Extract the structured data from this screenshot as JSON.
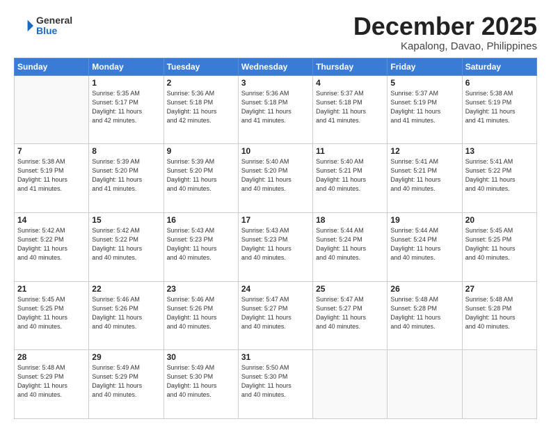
{
  "header": {
    "logo": {
      "general": "General",
      "blue": "Blue"
    },
    "month": "December 2025",
    "location": "Kapalong, Davao, Philippines"
  },
  "calendar": {
    "weekdays": [
      "Sunday",
      "Monday",
      "Tuesday",
      "Wednesday",
      "Thursday",
      "Friday",
      "Saturday"
    ],
    "weeks": [
      [
        {
          "day": "",
          "info": ""
        },
        {
          "day": "1",
          "info": "Sunrise: 5:35 AM\nSunset: 5:17 PM\nDaylight: 11 hours\nand 42 minutes."
        },
        {
          "day": "2",
          "info": "Sunrise: 5:36 AM\nSunset: 5:18 PM\nDaylight: 11 hours\nand 42 minutes."
        },
        {
          "day": "3",
          "info": "Sunrise: 5:36 AM\nSunset: 5:18 PM\nDaylight: 11 hours\nand 41 minutes."
        },
        {
          "day": "4",
          "info": "Sunrise: 5:37 AM\nSunset: 5:18 PM\nDaylight: 11 hours\nand 41 minutes."
        },
        {
          "day": "5",
          "info": "Sunrise: 5:37 AM\nSunset: 5:19 PM\nDaylight: 11 hours\nand 41 minutes."
        },
        {
          "day": "6",
          "info": "Sunrise: 5:38 AM\nSunset: 5:19 PM\nDaylight: 11 hours\nand 41 minutes."
        }
      ],
      [
        {
          "day": "7",
          "info": "Sunrise: 5:38 AM\nSunset: 5:19 PM\nDaylight: 11 hours\nand 41 minutes."
        },
        {
          "day": "8",
          "info": "Sunrise: 5:39 AM\nSunset: 5:20 PM\nDaylight: 11 hours\nand 41 minutes."
        },
        {
          "day": "9",
          "info": "Sunrise: 5:39 AM\nSunset: 5:20 PM\nDaylight: 11 hours\nand 40 minutes."
        },
        {
          "day": "10",
          "info": "Sunrise: 5:40 AM\nSunset: 5:20 PM\nDaylight: 11 hours\nand 40 minutes."
        },
        {
          "day": "11",
          "info": "Sunrise: 5:40 AM\nSunset: 5:21 PM\nDaylight: 11 hours\nand 40 minutes."
        },
        {
          "day": "12",
          "info": "Sunrise: 5:41 AM\nSunset: 5:21 PM\nDaylight: 11 hours\nand 40 minutes."
        },
        {
          "day": "13",
          "info": "Sunrise: 5:41 AM\nSunset: 5:22 PM\nDaylight: 11 hours\nand 40 minutes."
        }
      ],
      [
        {
          "day": "14",
          "info": "Sunrise: 5:42 AM\nSunset: 5:22 PM\nDaylight: 11 hours\nand 40 minutes."
        },
        {
          "day": "15",
          "info": "Sunrise: 5:42 AM\nSunset: 5:22 PM\nDaylight: 11 hours\nand 40 minutes."
        },
        {
          "day": "16",
          "info": "Sunrise: 5:43 AM\nSunset: 5:23 PM\nDaylight: 11 hours\nand 40 minutes."
        },
        {
          "day": "17",
          "info": "Sunrise: 5:43 AM\nSunset: 5:23 PM\nDaylight: 11 hours\nand 40 minutes."
        },
        {
          "day": "18",
          "info": "Sunrise: 5:44 AM\nSunset: 5:24 PM\nDaylight: 11 hours\nand 40 minutes."
        },
        {
          "day": "19",
          "info": "Sunrise: 5:44 AM\nSunset: 5:24 PM\nDaylight: 11 hours\nand 40 minutes."
        },
        {
          "day": "20",
          "info": "Sunrise: 5:45 AM\nSunset: 5:25 PM\nDaylight: 11 hours\nand 40 minutes."
        }
      ],
      [
        {
          "day": "21",
          "info": "Sunrise: 5:45 AM\nSunset: 5:25 PM\nDaylight: 11 hours\nand 40 minutes."
        },
        {
          "day": "22",
          "info": "Sunrise: 5:46 AM\nSunset: 5:26 PM\nDaylight: 11 hours\nand 40 minutes."
        },
        {
          "day": "23",
          "info": "Sunrise: 5:46 AM\nSunset: 5:26 PM\nDaylight: 11 hours\nand 40 minutes."
        },
        {
          "day": "24",
          "info": "Sunrise: 5:47 AM\nSunset: 5:27 PM\nDaylight: 11 hours\nand 40 minutes."
        },
        {
          "day": "25",
          "info": "Sunrise: 5:47 AM\nSunset: 5:27 PM\nDaylight: 11 hours\nand 40 minutes."
        },
        {
          "day": "26",
          "info": "Sunrise: 5:48 AM\nSunset: 5:28 PM\nDaylight: 11 hours\nand 40 minutes."
        },
        {
          "day": "27",
          "info": "Sunrise: 5:48 AM\nSunset: 5:28 PM\nDaylight: 11 hours\nand 40 minutes."
        }
      ],
      [
        {
          "day": "28",
          "info": "Sunrise: 5:48 AM\nSunset: 5:29 PM\nDaylight: 11 hours\nand 40 minutes."
        },
        {
          "day": "29",
          "info": "Sunrise: 5:49 AM\nSunset: 5:29 PM\nDaylight: 11 hours\nand 40 minutes."
        },
        {
          "day": "30",
          "info": "Sunrise: 5:49 AM\nSunset: 5:30 PM\nDaylight: 11 hours\nand 40 minutes."
        },
        {
          "day": "31",
          "info": "Sunrise: 5:50 AM\nSunset: 5:30 PM\nDaylight: 11 hours\nand 40 minutes."
        },
        {
          "day": "",
          "info": ""
        },
        {
          "day": "",
          "info": ""
        },
        {
          "day": "",
          "info": ""
        }
      ]
    ]
  }
}
